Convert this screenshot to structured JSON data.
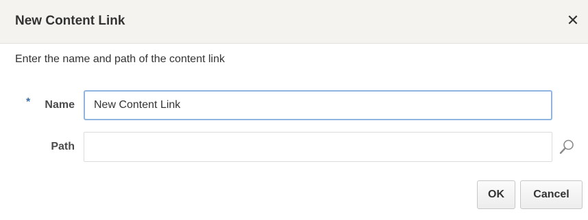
{
  "dialog": {
    "title": "New Content Link",
    "close_symbol": "✕",
    "close_icon": "close-icon",
    "instruction": "Enter the name and path of the content link"
  },
  "form": {
    "name": {
      "required_marker": "*",
      "label": "Name",
      "value": "New Content Link"
    },
    "path": {
      "label": "Path",
      "value": "",
      "search_icon": "search-icon"
    }
  },
  "buttons": {
    "ok": "OK",
    "cancel": "Cancel"
  },
  "colors": {
    "titlebar_bg": "#f4f3ef",
    "focus_border": "#8fb4e0",
    "required_marker": "#3b6ea5"
  }
}
